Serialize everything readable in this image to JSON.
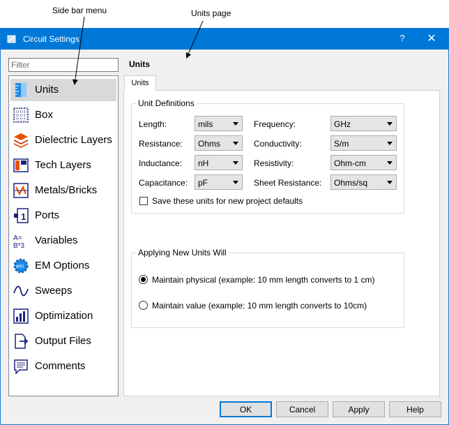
{
  "annotations": {
    "sidebar_callout": "Side bar menu",
    "page_callout": "Units page"
  },
  "window": {
    "title": "Circuit Settings",
    "help": "?",
    "close": "✕"
  },
  "filter": {
    "placeholder": "Filter",
    "value": ""
  },
  "sidebar": {
    "items": [
      {
        "label": "Units",
        "icon": "ruler-icon",
        "selected": true
      },
      {
        "label": "Box",
        "icon": "grid-box-icon"
      },
      {
        "label": "Dielectric Layers",
        "icon": "layers-icon"
      },
      {
        "label": "Tech Layers",
        "icon": "tech-layers-icon"
      },
      {
        "label": "Metals/Bricks",
        "icon": "metals-icon"
      },
      {
        "label": "Ports",
        "icon": "port-icon"
      },
      {
        "label": "Variables",
        "icon": "variables-icon"
      },
      {
        "label": "EM Options",
        "icon": "em-gear-icon"
      },
      {
        "label": "Sweeps",
        "icon": "sine-wave-icon"
      },
      {
        "label": "Optimization",
        "icon": "chart-icon"
      },
      {
        "label": "Output Files",
        "icon": "file-export-icon"
      },
      {
        "label": "Comments",
        "icon": "comment-icon"
      }
    ]
  },
  "page": {
    "title": "Units",
    "tab": "Units",
    "unit_definitions": {
      "title": "Unit Definitions",
      "left": [
        {
          "label": "Length:",
          "value": "mils"
        },
        {
          "label": "Resistance:",
          "value": "Ohms"
        },
        {
          "label": "Inductance:",
          "value": "nH"
        },
        {
          "label": "Capacitance:",
          "value": "pF"
        }
      ],
      "right": [
        {
          "label": "Frequency:",
          "value": "GHz"
        },
        {
          "label": "Conductivity:",
          "value": "S/m"
        },
        {
          "label": "Resistivity:",
          "value": "Ohm-cm"
        },
        {
          "label": "Sheet Resistance:",
          "value": "Ohms/sq"
        }
      ],
      "save_defaults": {
        "label": "Save these units for new project defaults",
        "checked": false
      }
    },
    "applying": {
      "title": "Applying New Units Will",
      "options": [
        {
          "label": "Maintain physical (example: 10 mm length converts to 1 cm)",
          "selected": true
        },
        {
          "label": "Maintain value (example: 10 mm length converts to 10cm)",
          "selected": false
        }
      ]
    }
  },
  "buttons": {
    "ok": "OK",
    "cancel": "Cancel",
    "apply": "Apply",
    "help": "Help"
  }
}
